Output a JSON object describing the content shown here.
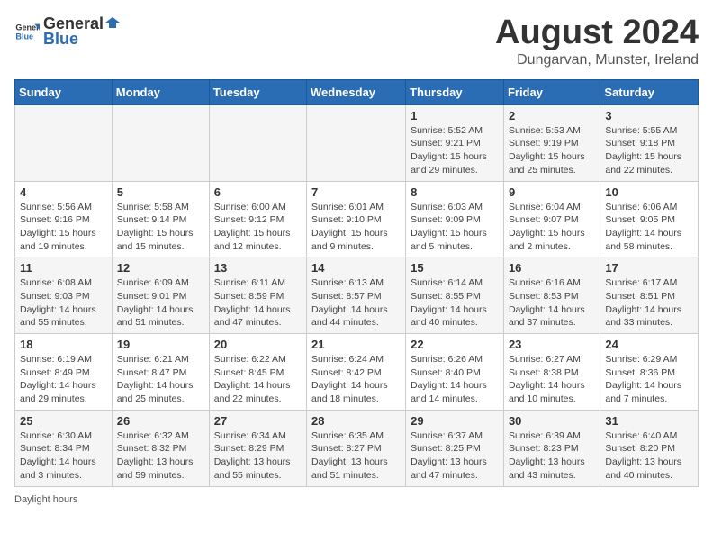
{
  "header": {
    "logo_general": "General",
    "logo_blue": "Blue",
    "month_year": "August 2024",
    "location": "Dungarvan, Munster, Ireland"
  },
  "days_of_week": [
    "Sunday",
    "Monday",
    "Tuesday",
    "Wednesday",
    "Thursday",
    "Friday",
    "Saturday"
  ],
  "weeks": [
    [
      {
        "day": "",
        "sunrise": "",
        "sunset": "",
        "daylight": ""
      },
      {
        "day": "",
        "sunrise": "",
        "sunset": "",
        "daylight": ""
      },
      {
        "day": "",
        "sunrise": "",
        "sunset": "",
        "daylight": ""
      },
      {
        "day": "",
        "sunrise": "",
        "sunset": "",
        "daylight": ""
      },
      {
        "day": "1",
        "sunrise": "Sunrise: 5:52 AM",
        "sunset": "Sunset: 9:21 PM",
        "daylight": "Daylight: 15 hours and 29 minutes."
      },
      {
        "day": "2",
        "sunrise": "Sunrise: 5:53 AM",
        "sunset": "Sunset: 9:19 PM",
        "daylight": "Daylight: 15 hours and 25 minutes."
      },
      {
        "day": "3",
        "sunrise": "Sunrise: 5:55 AM",
        "sunset": "Sunset: 9:18 PM",
        "daylight": "Daylight: 15 hours and 22 minutes."
      }
    ],
    [
      {
        "day": "4",
        "sunrise": "Sunrise: 5:56 AM",
        "sunset": "Sunset: 9:16 PM",
        "daylight": "Daylight: 15 hours and 19 minutes."
      },
      {
        "day": "5",
        "sunrise": "Sunrise: 5:58 AM",
        "sunset": "Sunset: 9:14 PM",
        "daylight": "Daylight: 15 hours and 15 minutes."
      },
      {
        "day": "6",
        "sunrise": "Sunrise: 6:00 AM",
        "sunset": "Sunset: 9:12 PM",
        "daylight": "Daylight: 15 hours and 12 minutes."
      },
      {
        "day": "7",
        "sunrise": "Sunrise: 6:01 AM",
        "sunset": "Sunset: 9:10 PM",
        "daylight": "Daylight: 15 hours and 9 minutes."
      },
      {
        "day": "8",
        "sunrise": "Sunrise: 6:03 AM",
        "sunset": "Sunset: 9:09 PM",
        "daylight": "Daylight: 15 hours and 5 minutes."
      },
      {
        "day": "9",
        "sunrise": "Sunrise: 6:04 AM",
        "sunset": "Sunset: 9:07 PM",
        "daylight": "Daylight: 15 hours and 2 minutes."
      },
      {
        "day": "10",
        "sunrise": "Sunrise: 6:06 AM",
        "sunset": "Sunset: 9:05 PM",
        "daylight": "Daylight: 14 hours and 58 minutes."
      }
    ],
    [
      {
        "day": "11",
        "sunrise": "Sunrise: 6:08 AM",
        "sunset": "Sunset: 9:03 PM",
        "daylight": "Daylight: 14 hours and 55 minutes."
      },
      {
        "day": "12",
        "sunrise": "Sunrise: 6:09 AM",
        "sunset": "Sunset: 9:01 PM",
        "daylight": "Daylight: 14 hours and 51 minutes."
      },
      {
        "day": "13",
        "sunrise": "Sunrise: 6:11 AM",
        "sunset": "Sunset: 8:59 PM",
        "daylight": "Daylight: 14 hours and 47 minutes."
      },
      {
        "day": "14",
        "sunrise": "Sunrise: 6:13 AM",
        "sunset": "Sunset: 8:57 PM",
        "daylight": "Daylight: 14 hours and 44 minutes."
      },
      {
        "day": "15",
        "sunrise": "Sunrise: 6:14 AM",
        "sunset": "Sunset: 8:55 PM",
        "daylight": "Daylight: 14 hours and 40 minutes."
      },
      {
        "day": "16",
        "sunrise": "Sunrise: 6:16 AM",
        "sunset": "Sunset: 8:53 PM",
        "daylight": "Daylight: 14 hours and 37 minutes."
      },
      {
        "day": "17",
        "sunrise": "Sunrise: 6:17 AM",
        "sunset": "Sunset: 8:51 PM",
        "daylight": "Daylight: 14 hours and 33 minutes."
      }
    ],
    [
      {
        "day": "18",
        "sunrise": "Sunrise: 6:19 AM",
        "sunset": "Sunset: 8:49 PM",
        "daylight": "Daylight: 14 hours and 29 minutes."
      },
      {
        "day": "19",
        "sunrise": "Sunrise: 6:21 AM",
        "sunset": "Sunset: 8:47 PM",
        "daylight": "Daylight: 14 hours and 25 minutes."
      },
      {
        "day": "20",
        "sunrise": "Sunrise: 6:22 AM",
        "sunset": "Sunset: 8:45 PM",
        "daylight": "Daylight: 14 hours and 22 minutes."
      },
      {
        "day": "21",
        "sunrise": "Sunrise: 6:24 AM",
        "sunset": "Sunset: 8:42 PM",
        "daylight": "Daylight: 14 hours and 18 minutes."
      },
      {
        "day": "22",
        "sunrise": "Sunrise: 6:26 AM",
        "sunset": "Sunset: 8:40 PM",
        "daylight": "Daylight: 14 hours and 14 minutes."
      },
      {
        "day": "23",
        "sunrise": "Sunrise: 6:27 AM",
        "sunset": "Sunset: 8:38 PM",
        "daylight": "Daylight: 14 hours and 10 minutes."
      },
      {
        "day": "24",
        "sunrise": "Sunrise: 6:29 AM",
        "sunset": "Sunset: 8:36 PM",
        "daylight": "Daylight: 14 hours and 7 minutes."
      }
    ],
    [
      {
        "day": "25",
        "sunrise": "Sunrise: 6:30 AM",
        "sunset": "Sunset: 8:34 PM",
        "daylight": "Daylight: 14 hours and 3 minutes."
      },
      {
        "day": "26",
        "sunrise": "Sunrise: 6:32 AM",
        "sunset": "Sunset: 8:32 PM",
        "daylight": "Daylight: 13 hours and 59 minutes."
      },
      {
        "day": "27",
        "sunrise": "Sunrise: 6:34 AM",
        "sunset": "Sunset: 8:29 PM",
        "daylight": "Daylight: 13 hours and 55 minutes."
      },
      {
        "day": "28",
        "sunrise": "Sunrise: 6:35 AM",
        "sunset": "Sunset: 8:27 PM",
        "daylight": "Daylight: 13 hours and 51 minutes."
      },
      {
        "day": "29",
        "sunrise": "Sunrise: 6:37 AM",
        "sunset": "Sunset: 8:25 PM",
        "daylight": "Daylight: 13 hours and 47 minutes."
      },
      {
        "day": "30",
        "sunrise": "Sunrise: 6:39 AM",
        "sunset": "Sunset: 8:23 PM",
        "daylight": "Daylight: 13 hours and 43 minutes."
      },
      {
        "day": "31",
        "sunrise": "Sunrise: 6:40 AM",
        "sunset": "Sunset: 8:20 PM",
        "daylight": "Daylight: 13 hours and 40 minutes."
      }
    ]
  ],
  "footer": {
    "daylight_label": "Daylight hours"
  }
}
